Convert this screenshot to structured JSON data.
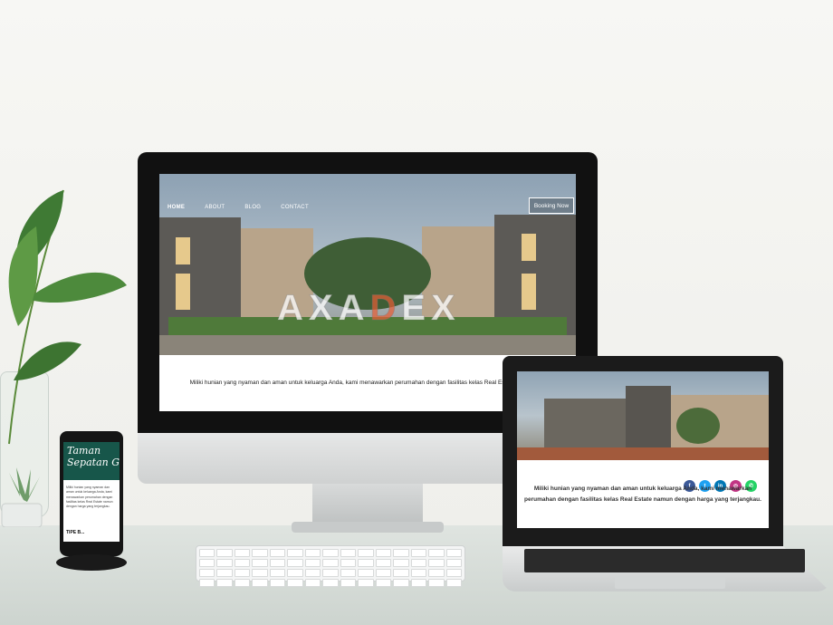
{
  "imac_site": {
    "nav": [
      "HOME",
      "ABOUT",
      "BLOG",
      "CONTACT"
    ],
    "booking_label": "Booking Now",
    "intro_text": "Miliki hunian yang nyaman dan aman untuk keluarga Anda, kami menawarkan perumahan dengan fasilitas kelas Real Estate terjangkau."
  },
  "watermark": {
    "text_a": "AXA",
    "text_b": "D",
    "text_c": "EX"
  },
  "laptop_site": {
    "intro_line1": "Miliki hunian yang nyaman dan aman untuk keluarga Anda, kami menawarkan",
    "intro_line2": "perumahan dengan fasilitas kelas Real Estate namun dengan harga yang terjangkau.",
    "social": [
      {
        "name": "facebook",
        "glyph": "f",
        "color": "#3b5998"
      },
      {
        "name": "twitter",
        "glyph": "t",
        "color": "#1da1f2"
      },
      {
        "name": "linkedin",
        "glyph": "in",
        "color": "#0077b5"
      },
      {
        "name": "instagram",
        "glyph": "◎",
        "color": "#c13584"
      },
      {
        "name": "whatsapp",
        "glyph": "✆",
        "color": "#25d366"
      }
    ]
  },
  "phone_site": {
    "title_line1": "Taman",
    "title_line2": "Sepatan G",
    "body": "Miliki hunian yang nyaman dan aman untuk keluarga Anda, kami menawarkan perumahan dengan fasilitas kelas Real Estate namun dengan harga yang terjangkau.",
    "tipe_label": "TIPE B..."
  }
}
